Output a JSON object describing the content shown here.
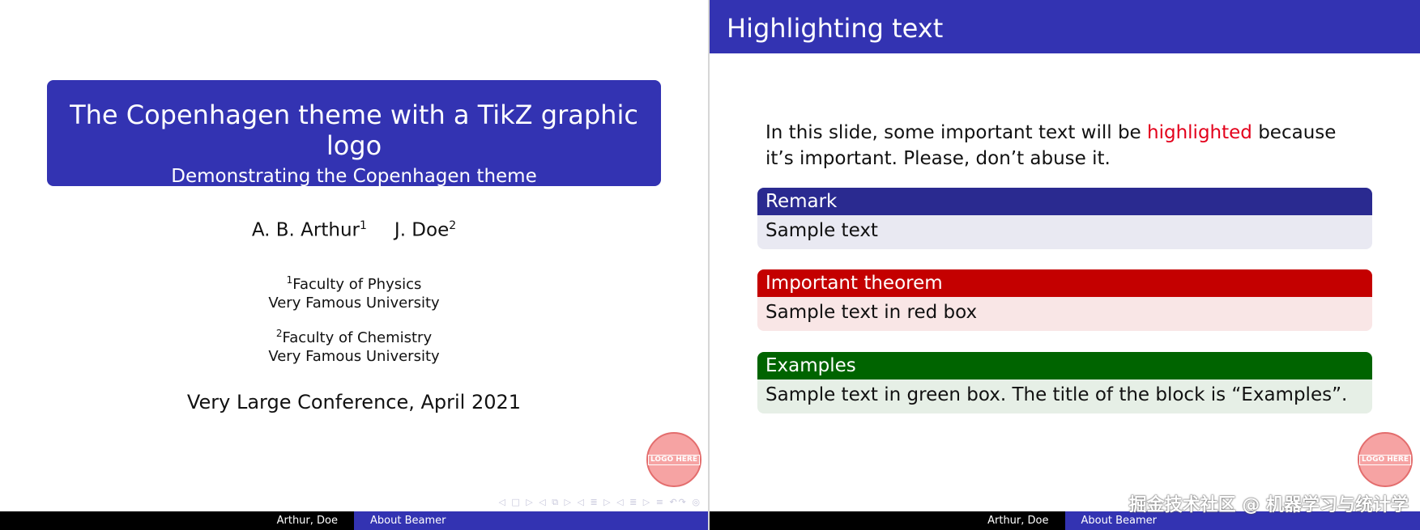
{
  "slide1": {
    "title": "The Copenhagen theme with a TikZ graphic logo",
    "subtitle": "Demonstrating the Copenhagen theme",
    "author1": "A. B. Arthur",
    "author1_sup": "1",
    "author2": "J. Doe",
    "author2_sup": "2",
    "inst1_sup": "1",
    "inst1_line1": "Faculty of Physics",
    "inst1_line2": "Very Famous University",
    "inst2_sup": "2",
    "inst2_line1": "Faculty of Chemistry",
    "inst2_line2": "Very Famous University",
    "conference": "Very Large Conference, April 2021",
    "logo_text": "LOGO HERE",
    "footer_left": "Arthur, Doe",
    "footer_right": "About Beamer"
  },
  "slide2": {
    "frame_title": "Highlighting text",
    "para_before": "In this slide, some important text will be ",
    "para_highlight": "highlighted",
    "para_after": " because it’s important. Please, don’t abuse it.",
    "blocks": [
      {
        "title": "Remark",
        "body": "Sample text"
      },
      {
        "title": "Important theorem",
        "body": "Sample text in red box"
      },
      {
        "title": "Examples",
        "body": "Sample text in green box. The title of the block is “Examples”."
      }
    ],
    "logo_text": "LOGO HERE",
    "footer_left": "Arthur, Doe",
    "footer_right": "About Beamer"
  },
  "nav_symbols": "◁ □ ▷ ◁ ⧉ ▷ ◁ ≣ ▷ ◁ ≣ ▷   ≡   ↶↷ ◎",
  "watermark": "掘金技术社区 @ 机器学习与统计学",
  "colors": {
    "structure": "#3333b2",
    "alert": "#e3001b",
    "block_red": "#c40000",
    "block_green": "#006400",
    "footer_dark": "#000000"
  }
}
